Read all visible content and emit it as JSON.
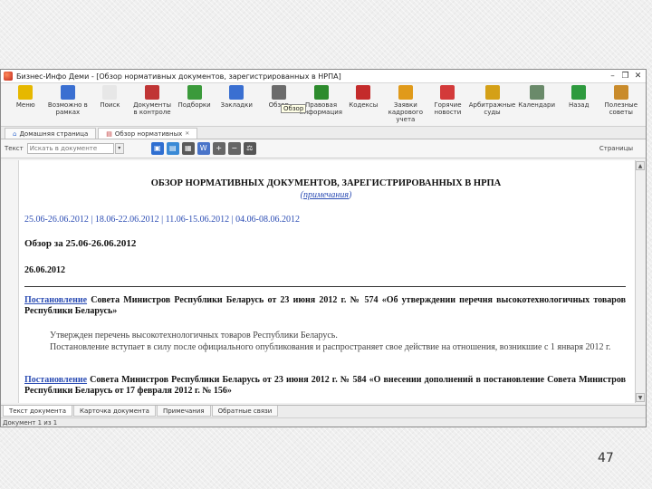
{
  "window": {
    "title": "Бизнес-Инфо Деми - [Обзор нормативных документов, зарегистрированных в НРПА]",
    "minimize": "–",
    "restore": "❐",
    "close": "✕"
  },
  "toolbar": {
    "items": [
      {
        "label": "Меню",
        "icon": "smiley-icon",
        "color": "#e6b800"
      },
      {
        "label": "Возможно в рамках",
        "icon": "book-icon",
        "color": "#3a6fd1"
      },
      {
        "label": "Поиск",
        "icon": "search-icon",
        "color": "#e7e7e7"
      },
      {
        "label": "Документы в контроле",
        "icon": "check-doc-icon",
        "color": "#c03535"
      },
      {
        "label": "Подборки",
        "icon": "folders-icon",
        "color": "#3b9a3b"
      },
      {
        "label": "Закладки",
        "icon": "bookmark-icon",
        "color": "#3a6fd1"
      },
      {
        "label": "Обзор",
        "icon": "binoculars-icon",
        "color": "#6b6b6b"
      },
      {
        "label": "Правовая информация",
        "icon": "excel-icon",
        "color": "#2d8b2d"
      },
      {
        "label": "Кодексы",
        "icon": "codex-icon",
        "color": "#c42b2b"
      },
      {
        "label": "Заявки кадрового учета",
        "icon": "notebook-icon",
        "color": "#e09a1a"
      },
      {
        "label": "Горячие новости",
        "icon": "fire-icon",
        "color": "#d33a3a"
      },
      {
        "label": "Арбитражные суды",
        "icon": "scales-icon",
        "color": "#d4a017"
      },
      {
        "label": "Календари",
        "icon": "calendar-icon",
        "color": "#6a8a6a"
      },
      {
        "label": "Назад",
        "icon": "back-arrow-icon",
        "color": "#2e9a3e"
      },
      {
        "label": "Полезные советы",
        "icon": "tips-icon",
        "color": "#c98b2b"
      }
    ]
  },
  "tooltip": "Обзор",
  "tabs": [
    {
      "label": "Домашняя страница",
      "icon": "home-icon"
    },
    {
      "label": "Обзор нормативных",
      "icon": "doc-icon",
      "close": "✕"
    }
  ],
  "subbar": {
    "text_label": "Текст",
    "search_placeholder": "Искать в документе",
    "search_btn": "▾",
    "doc_icons": [
      {
        "name": "print-preview-icon",
        "color": "#2f6fd1",
        "glyph": "▣"
      },
      {
        "name": "save-icon",
        "color": "#3a8ad6",
        "glyph": "▤"
      },
      {
        "name": "print-icon",
        "color": "#5a5a5a",
        "glyph": "▦"
      },
      {
        "name": "export-word-icon",
        "color": "#4a74c9",
        "glyph": "W"
      },
      {
        "name": "zoom-in-icon",
        "color": "#666666",
        "glyph": "+"
      },
      {
        "name": "zoom-out-icon",
        "color": "#666666",
        "glyph": "−"
      },
      {
        "name": "compare-icon",
        "color": "#555555",
        "glyph": "⚖"
      }
    ],
    "pages_label": "Страницы"
  },
  "scrollbar": {
    "up": "▲",
    "down": "▼"
  },
  "document": {
    "title": "ОБЗОР НОРМАТИВНЫХ ДОКУМЕНТОВ, ЗАРЕГИСТРИРОВАННЫХ В НРПА",
    "notes_link": "примечания",
    "date_nav": "25.06-26.06.2012   |   18.06-22.06.2012   |   11.06-15.06.2012   |   04.06-08.06.2012",
    "review_heading": "Обзор за 25.06-26.06.2012",
    "date_heading": "26.06.2012",
    "p1_link": "Постановление",
    "p1_text": " Совета Министров Республики Беларусь от 23 июня 2012 г. № 574 «Об утверждении перечня высокотехнологичных товаров Республики Беларусь»",
    "p2_text": "Утвержден перечень высокотехнологичных товаров Республики Беларусь.",
    "p3_text": "Постановление вступает в силу после официального опубликования и распространяет свое действие на отношения, возникшие с 1 января 2012 г.",
    "p4_link": "Постановление",
    "p4_text": " Совета Министров Республики Беларусь от 23 июня 2012 г. № 584 «О внесении дополнений в постановление Совета Министров Республики Беларусь от 17 февраля 2012 г. № 156»"
  },
  "bottom_tabs": [
    "Текст документа",
    "Карточка документа",
    "Примечания",
    "Обратные связи"
  ],
  "status": "Документ 1 из 1",
  "slide_number": "47"
}
